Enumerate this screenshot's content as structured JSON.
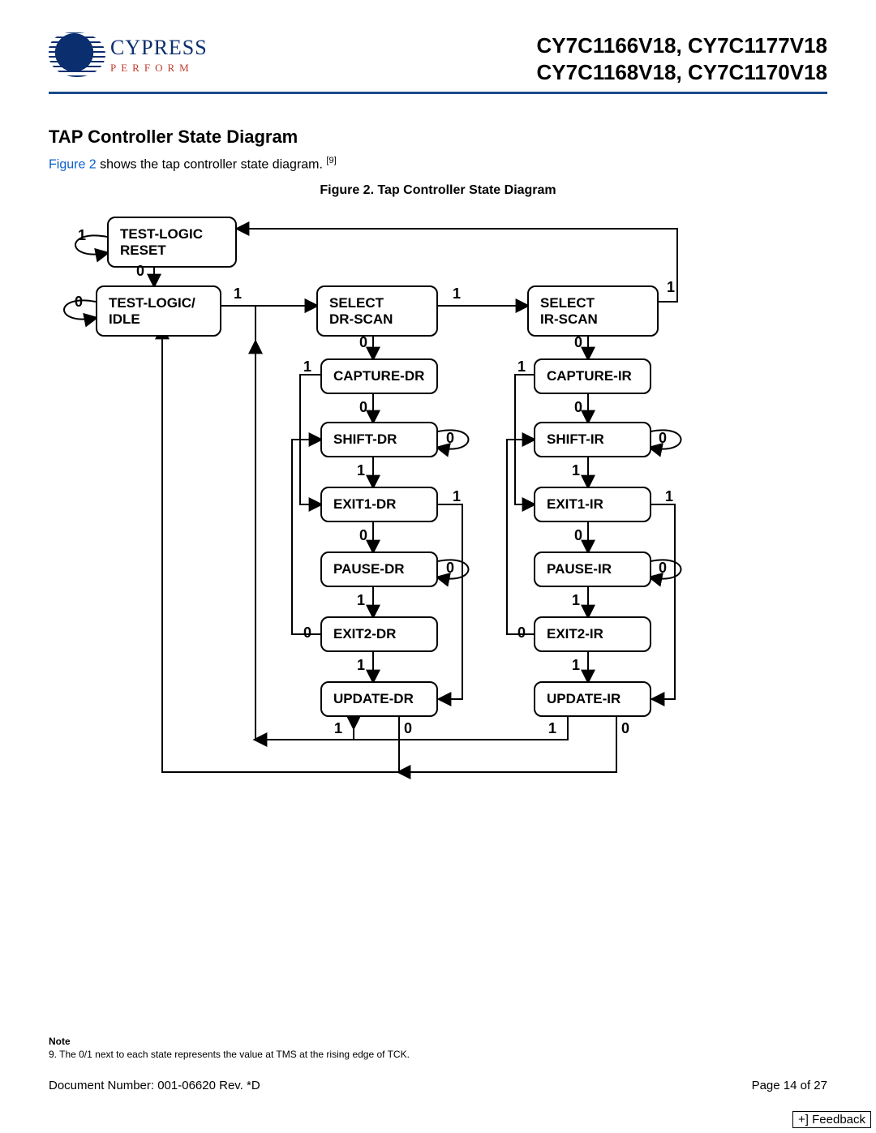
{
  "header": {
    "logo_name": "CYPRESS",
    "logo_sub": "PERFORM",
    "parts_line1": "CY7C1166V18, CY7C1177V18",
    "parts_line2": "CY7C1168V18, CY7C1170V18"
  },
  "section": {
    "title": "TAP Controller State Diagram",
    "intro_figlink": "Figure 2",
    "intro_rest": " shows the tap controller state diagram. ",
    "intro_sup": "[9]",
    "fig_caption": "Figure 2. Tap Controller State Diagram"
  },
  "states": {
    "tlr": "TEST-LOGIC\nRESET",
    "rti": "TEST-LOGIC/\nIDLE",
    "sel_dr": "SELECT\nDR-SCAN",
    "sel_ir": "SELECT\nIR-SCAN",
    "cap_dr": "CAPTURE-DR",
    "cap_ir": "CAPTURE-IR",
    "shift_dr": "SHIFT-DR",
    "shift_ir": "SHIFT-IR",
    "exit1_dr": "EXIT1-DR",
    "exit1_ir": "EXIT1-IR",
    "pause_dr": "PAUSE-DR",
    "pause_ir": "PAUSE-IR",
    "exit2_dr": "EXIT2-DR",
    "exit2_ir": "EXIT2-IR",
    "update_dr": "UPDATE-DR",
    "update_ir": "UPDATE-IR"
  },
  "labels": {
    "l0": "0",
    "l1": "1"
  },
  "note": {
    "heading": "Note",
    "text": "9.  The 0/1 next to each state represents the value at TMS at the rising edge of TCK."
  },
  "footer": {
    "docnum": "Document Number: 001-06620  Rev. *D",
    "page": "Page 14 of 27"
  },
  "feedback": "+] Feedback"
}
